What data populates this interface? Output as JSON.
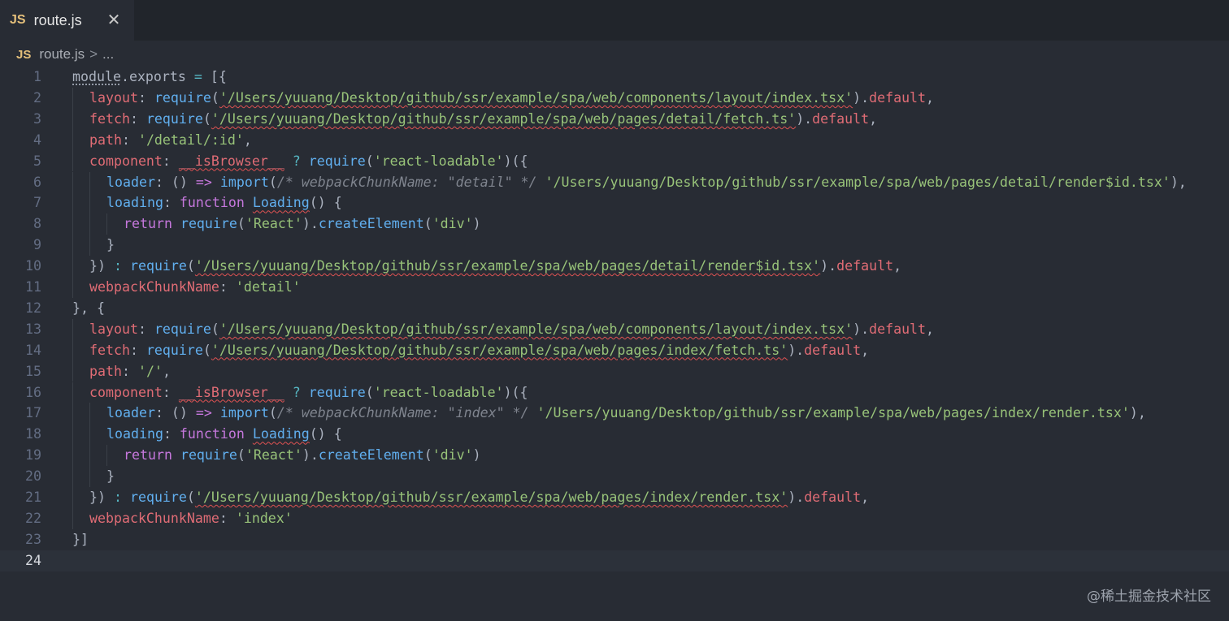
{
  "tab": {
    "badge": "JS",
    "filename": "route.js",
    "close_glyph": "✕"
  },
  "breadcrumb": {
    "badge": "JS",
    "file": "route.js",
    "separator": ">",
    "more": "..."
  },
  "editor": {
    "current_line": 24,
    "lines": [
      {
        "n": "1",
        "indent": 0,
        "tokens": [
          [
            "pl dots",
            "module"
          ],
          [
            "pl",
            "."
          ],
          [
            "pl",
            "exports"
          ],
          [
            "op",
            " = "
          ],
          [
            "pl",
            "[{"
          ]
        ]
      },
      {
        "n": "2",
        "indent": 1,
        "tokens": [
          [
            "prop",
            "layout"
          ],
          [
            "pl",
            ": "
          ],
          [
            "fn",
            "require"
          ],
          [
            "pl",
            "("
          ],
          [
            "str squig",
            "'/Users/yuuang/Desktop/github/ssr/example/spa/web/components/layout/index.tsx'"
          ],
          [
            "pl",
            ")."
          ],
          [
            "prop",
            "default"
          ],
          [
            "pl",
            ","
          ]
        ]
      },
      {
        "n": "3",
        "indent": 1,
        "tokens": [
          [
            "prop",
            "fetch"
          ],
          [
            "pl",
            ": "
          ],
          [
            "fn",
            "require"
          ],
          [
            "pl",
            "("
          ],
          [
            "str squig",
            "'/Users/yuuang/Desktop/github/ssr/example/spa/web/pages/detail/fetch.ts'"
          ],
          [
            "pl",
            ")."
          ],
          [
            "prop",
            "default"
          ],
          [
            "pl",
            ","
          ]
        ]
      },
      {
        "n": "4",
        "indent": 1,
        "tokens": [
          [
            "prop",
            "path"
          ],
          [
            "pl",
            ": "
          ],
          [
            "str",
            "'/detail/:id'"
          ],
          [
            "pl",
            ","
          ]
        ]
      },
      {
        "n": "5",
        "indent": 1,
        "tokens": [
          [
            "prop",
            "component"
          ],
          [
            "pl",
            ": "
          ],
          [
            "prop squig",
            "__isBrowser__"
          ],
          [
            "op",
            " ? "
          ],
          [
            "fn",
            "require"
          ],
          [
            "pl",
            "("
          ],
          [
            "str",
            "'react-loadable'"
          ],
          [
            "pl",
            ")({"
          ]
        ]
      },
      {
        "n": "6",
        "indent": 2,
        "tokens": [
          [
            "fn",
            "loader"
          ],
          [
            "pl",
            ": () "
          ],
          [
            "kw",
            "=>"
          ],
          [
            "pl",
            " "
          ],
          [
            "fn",
            "import"
          ],
          [
            "pl",
            "("
          ],
          [
            "cm",
            "/* webpackChunkName: \"detail\" */"
          ],
          [
            "pl",
            " "
          ],
          [
            "str",
            "'/Users/yuuang/Desktop/github/ssr/example/spa/web/pages/detail/render$id.tsx'"
          ],
          [
            "pl",
            "),"
          ]
        ]
      },
      {
        "n": "7",
        "indent": 2,
        "tokens": [
          [
            "fn",
            "loading"
          ],
          [
            "pl",
            ": "
          ],
          [
            "kw",
            "function"
          ],
          [
            "pl",
            " "
          ],
          [
            "fn squig",
            "Loading"
          ],
          [
            "pl",
            "() {"
          ]
        ]
      },
      {
        "n": "8",
        "indent": 3,
        "tokens": [
          [
            "kw",
            "return"
          ],
          [
            "pl",
            " "
          ],
          [
            "fn",
            "require"
          ],
          [
            "pl",
            "("
          ],
          [
            "str",
            "'React'"
          ],
          [
            "pl",
            ")."
          ],
          [
            "fn",
            "createElement"
          ],
          [
            "pl",
            "("
          ],
          [
            "str",
            "'div'"
          ],
          [
            "pl",
            ")"
          ]
        ]
      },
      {
        "n": "9",
        "indent": 2,
        "tokens": [
          [
            "pl",
            "}"
          ]
        ]
      },
      {
        "n": "10",
        "indent": 1,
        "tokens": [
          [
            "pl",
            "})"
          ],
          [
            "op",
            " : "
          ],
          [
            "fn",
            "require"
          ],
          [
            "pl",
            "("
          ],
          [
            "str squig",
            "'/Users/yuuang/Desktop/github/ssr/example/spa/web/pages/detail/render$id.tsx'"
          ],
          [
            "pl",
            ")."
          ],
          [
            "prop",
            "default"
          ],
          [
            "pl",
            ","
          ]
        ]
      },
      {
        "n": "11",
        "indent": 1,
        "tokens": [
          [
            "prop",
            "webpackChunkName"
          ],
          [
            "pl",
            ": "
          ],
          [
            "str",
            "'detail'"
          ]
        ]
      },
      {
        "n": "12",
        "indent": 0,
        "tokens": [
          [
            "pl",
            "}, {"
          ]
        ]
      },
      {
        "n": "13",
        "indent": 1,
        "tokens": [
          [
            "prop",
            "layout"
          ],
          [
            "pl",
            ": "
          ],
          [
            "fn",
            "require"
          ],
          [
            "pl",
            "("
          ],
          [
            "str squig",
            "'/Users/yuuang/Desktop/github/ssr/example/spa/web/components/layout/index.tsx'"
          ],
          [
            "pl",
            ")."
          ],
          [
            "prop",
            "default"
          ],
          [
            "pl",
            ","
          ]
        ]
      },
      {
        "n": "14",
        "indent": 1,
        "tokens": [
          [
            "prop",
            "fetch"
          ],
          [
            "pl",
            ": "
          ],
          [
            "fn",
            "require"
          ],
          [
            "pl",
            "("
          ],
          [
            "str squig",
            "'/Users/yuuang/Desktop/github/ssr/example/spa/web/pages/index/fetch.ts'"
          ],
          [
            "pl",
            ")."
          ],
          [
            "prop",
            "default"
          ],
          [
            "pl",
            ","
          ]
        ]
      },
      {
        "n": "15",
        "indent": 1,
        "tokens": [
          [
            "prop",
            "path"
          ],
          [
            "pl",
            ": "
          ],
          [
            "str",
            "'/'"
          ],
          [
            "pl",
            ","
          ]
        ]
      },
      {
        "n": "16",
        "indent": 1,
        "tokens": [
          [
            "prop",
            "component"
          ],
          [
            "pl",
            ": "
          ],
          [
            "prop squig",
            "__isBrowser__"
          ],
          [
            "op",
            " ? "
          ],
          [
            "fn",
            "require"
          ],
          [
            "pl",
            "("
          ],
          [
            "str",
            "'react-loadable'"
          ],
          [
            "pl",
            ")({"
          ]
        ]
      },
      {
        "n": "17",
        "indent": 2,
        "tokens": [
          [
            "fn",
            "loader"
          ],
          [
            "pl",
            ": () "
          ],
          [
            "kw",
            "=>"
          ],
          [
            "pl",
            " "
          ],
          [
            "fn",
            "import"
          ],
          [
            "pl",
            "("
          ],
          [
            "cm",
            "/* webpackChunkName: \"index\" */"
          ],
          [
            "pl",
            " "
          ],
          [
            "str",
            "'/Users/yuuang/Desktop/github/ssr/example/spa/web/pages/index/render.tsx'"
          ],
          [
            "pl",
            "),"
          ]
        ]
      },
      {
        "n": "18",
        "indent": 2,
        "tokens": [
          [
            "fn",
            "loading"
          ],
          [
            "pl",
            ": "
          ],
          [
            "kw",
            "function"
          ],
          [
            "pl",
            " "
          ],
          [
            "fn squig",
            "Loading"
          ],
          [
            "pl",
            "() {"
          ]
        ]
      },
      {
        "n": "19",
        "indent": 3,
        "tokens": [
          [
            "kw",
            "return"
          ],
          [
            "pl",
            " "
          ],
          [
            "fn",
            "require"
          ],
          [
            "pl",
            "("
          ],
          [
            "str",
            "'React'"
          ],
          [
            "pl",
            ")."
          ],
          [
            "fn",
            "createElement"
          ],
          [
            "pl",
            "("
          ],
          [
            "str",
            "'div'"
          ],
          [
            "pl",
            ")"
          ]
        ]
      },
      {
        "n": "20",
        "indent": 2,
        "tokens": [
          [
            "pl",
            "}"
          ]
        ]
      },
      {
        "n": "21",
        "indent": 1,
        "tokens": [
          [
            "pl",
            "})"
          ],
          [
            "op",
            " : "
          ],
          [
            "fn",
            "require"
          ],
          [
            "pl",
            "("
          ],
          [
            "str squig",
            "'/Users/yuuang/Desktop/github/ssr/example/spa/web/pages/index/render.tsx'"
          ],
          [
            "pl",
            ")."
          ],
          [
            "prop",
            "default"
          ],
          [
            "pl",
            ","
          ]
        ]
      },
      {
        "n": "22",
        "indent": 1,
        "tokens": [
          [
            "prop",
            "webpackChunkName"
          ],
          [
            "pl",
            ": "
          ],
          [
            "str",
            "'index'"
          ]
        ]
      },
      {
        "n": "23",
        "indent": 0,
        "tokens": [
          [
            "pl",
            "}]"
          ]
        ]
      },
      {
        "n": "24",
        "indent": 0,
        "tokens": []
      }
    ]
  },
  "watermark": "@稀土掘金技术社区",
  "colors": {
    "background": "#282c34",
    "tabbar": "#21252b",
    "keyword": "#c678dd",
    "string": "#98c379",
    "function": "#61afef",
    "property": "#e06c75",
    "comment": "#7f848e",
    "error_squiggle": "#e05252"
  }
}
